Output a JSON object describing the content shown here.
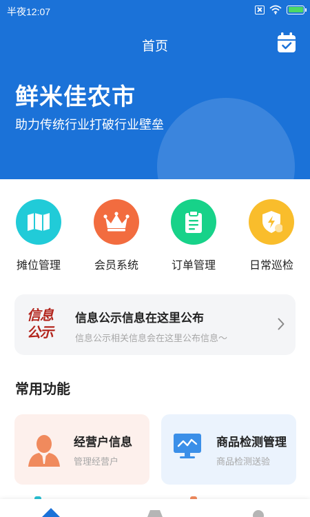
{
  "status_bar": {
    "time": "半夜12:07"
  },
  "header": {
    "title": "首页"
  },
  "hero": {
    "app_name": "鲜米佳农市",
    "slogan": "助力传统行业打破行业壁垒"
  },
  "quick_actions": [
    {
      "label": "摊位管理",
      "icon": "map-icon",
      "color": "#21cbd8"
    },
    {
      "label": "会员系统",
      "icon": "crown-icon",
      "color": "#f26c3f"
    },
    {
      "label": "订单管理",
      "icon": "clipboard-icon",
      "color": "#17d289"
    },
    {
      "label": "日常巡检",
      "icon": "shield-lightning-icon",
      "color": "#f9bd2c"
    }
  ],
  "notice": {
    "badge_line1": "信息",
    "badge_line2": "公示",
    "title": "信息公示信息在这里公布",
    "subtitle": "信息公示相关信息会在这里公布信息～"
  },
  "section": {
    "title": "常用功能"
  },
  "cards": [
    {
      "title": "经营户信息",
      "subtitle": "管理经营户",
      "icon": "merchant-person-icon"
    },
    {
      "title": "商品检测管理",
      "subtitle": "商品检测送验",
      "icon": "monitor-chart-icon"
    }
  ],
  "colors": {
    "primary": "#1b72d8",
    "accent_red": "#b3261e"
  }
}
